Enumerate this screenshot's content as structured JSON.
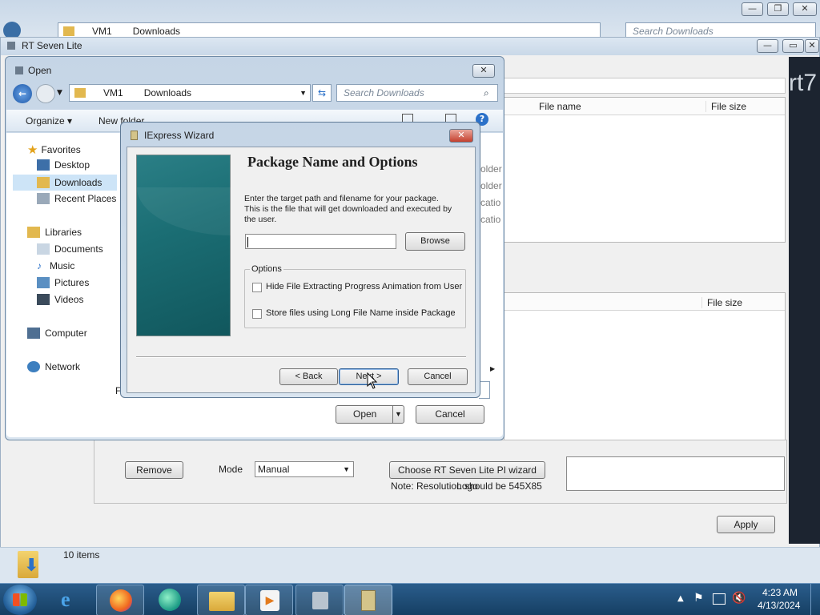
{
  "explorer_bg": {
    "address": [
      "VM1",
      "Downloads"
    ],
    "search_placeholder": "Search Downloads"
  },
  "rt_window": {
    "title": "RT Seven Lite",
    "brand_fragment": "rt7",
    "columns_top": [
      "File name",
      "File size"
    ],
    "columns_bottom": [
      "File size"
    ],
    "side_fragments": [
      "older",
      "older",
      "catio",
      "catio"
    ],
    "remove_label": "Remove",
    "mode_label": "Mode",
    "mode_value": "Manual",
    "logo_button": "Choose RT Seven Lite PI wizard Logo",
    "note": "Note: Resolution should be 545X85",
    "apply_label": "Apply",
    "items_count": "10 items"
  },
  "open_dialog": {
    "title": "Open",
    "address": [
      "VM1",
      "Downloads"
    ],
    "search_placeholder": "Search Downloads",
    "organize": "Organize",
    "new_folder": "New folder",
    "favorites": "Favorites",
    "nav": {
      "desktop": "Desktop",
      "downloads": "Downloads",
      "recent": "Recent Places",
      "libraries": "Libraries",
      "documents": "Documents",
      "music": "Music",
      "pictures": "Pictures",
      "videos": "Videos",
      "computer": "Computer",
      "network": "Network"
    },
    "filename_fragment": "F",
    "open_label": "Open",
    "cancel_label": "Cancel"
  },
  "wizard": {
    "title": "IExpress Wizard",
    "heading": "Package Name and Options",
    "desc_lines": [
      "Enter the target path and filename for your package.",
      "This is the file that will get downloaded and executed by",
      "the user."
    ],
    "path_value": "",
    "browse_label": "Browse",
    "options_label": "Options",
    "option1": "Hide File Extracting Progress Animation from User",
    "option2": "Store files using Long File Name inside Package",
    "back_label": "< Back",
    "next_label": "Next >",
    "cancel_label": "Cancel"
  },
  "taskbar": {
    "time": "4:23 AM",
    "date": "4/13/2024"
  },
  "colors": {
    "accent": "#3a6ea5",
    "wizard_panel": "#1b6e74",
    "taskbar": "#1d4f7a"
  }
}
